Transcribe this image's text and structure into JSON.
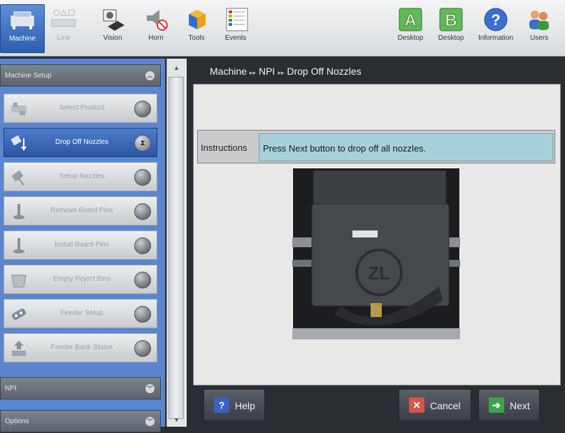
{
  "toolbar": {
    "left": [
      {
        "label": "Machine",
        "icon": "machine-icon",
        "state": "active"
      },
      {
        "label": "Line",
        "icon": "line-icon",
        "state": "disabled"
      },
      {
        "label": "Vision",
        "icon": "camera-icon",
        "state": "normal"
      },
      {
        "label": "Horn",
        "icon": "horn-icon",
        "state": "normal"
      },
      {
        "label": "Tools",
        "icon": "tools-icon",
        "state": "normal"
      },
      {
        "label": "Events",
        "icon": "events-icon",
        "state": "normal"
      }
    ],
    "right": [
      {
        "label": "Desktop",
        "icon": "desktop-a-icon",
        "letter": "A"
      },
      {
        "label": "Desktop",
        "icon": "desktop-b-icon",
        "letter": "B"
      },
      {
        "label": "Information",
        "icon": "information-icon",
        "letter": "?"
      },
      {
        "label": "Users",
        "icon": "users-icon",
        "letter": ""
      }
    ]
  },
  "sidebar": {
    "machine_setup": "Machine Setup",
    "steps": [
      {
        "label": "Select Product",
        "icon": "select-product-icon"
      },
      {
        "label": "Drop Off Nozzles",
        "icon": "drop-off-nozzles-icon",
        "active": true
      },
      {
        "label": "Setup Nozzles",
        "icon": "setup-nozzles-icon"
      },
      {
        "label": "Remove Board Pins",
        "icon": "remove-board-pins-icon"
      },
      {
        "label": "Install Board Pins",
        "icon": "install-board-pins-icon"
      },
      {
        "label": "Empty Reject Bins",
        "icon": "empty-reject-bins-icon"
      },
      {
        "label": "Feeder Setup",
        "icon": "feeder-setup-icon"
      },
      {
        "label": "Feeder Bank Status",
        "icon": "feeder-bank-status-icon"
      }
    ],
    "npi": "NPI",
    "options": "Options"
  },
  "breadcrumb": {
    "level1": "Machine",
    "level2": "NPI",
    "level3": "Drop Off Nozzles"
  },
  "instructions": {
    "label": "Instructions",
    "text": "Press Next button to drop off all nozzles."
  },
  "buttons": {
    "help": "Help",
    "cancel": "Cancel",
    "next": "Next"
  },
  "colors": {
    "accent": "#2c5fae",
    "instruction_bg": "#a8d0dc",
    "cancel": "#d9534f",
    "next": "#3fa34d",
    "help": "#3d5fc2"
  }
}
